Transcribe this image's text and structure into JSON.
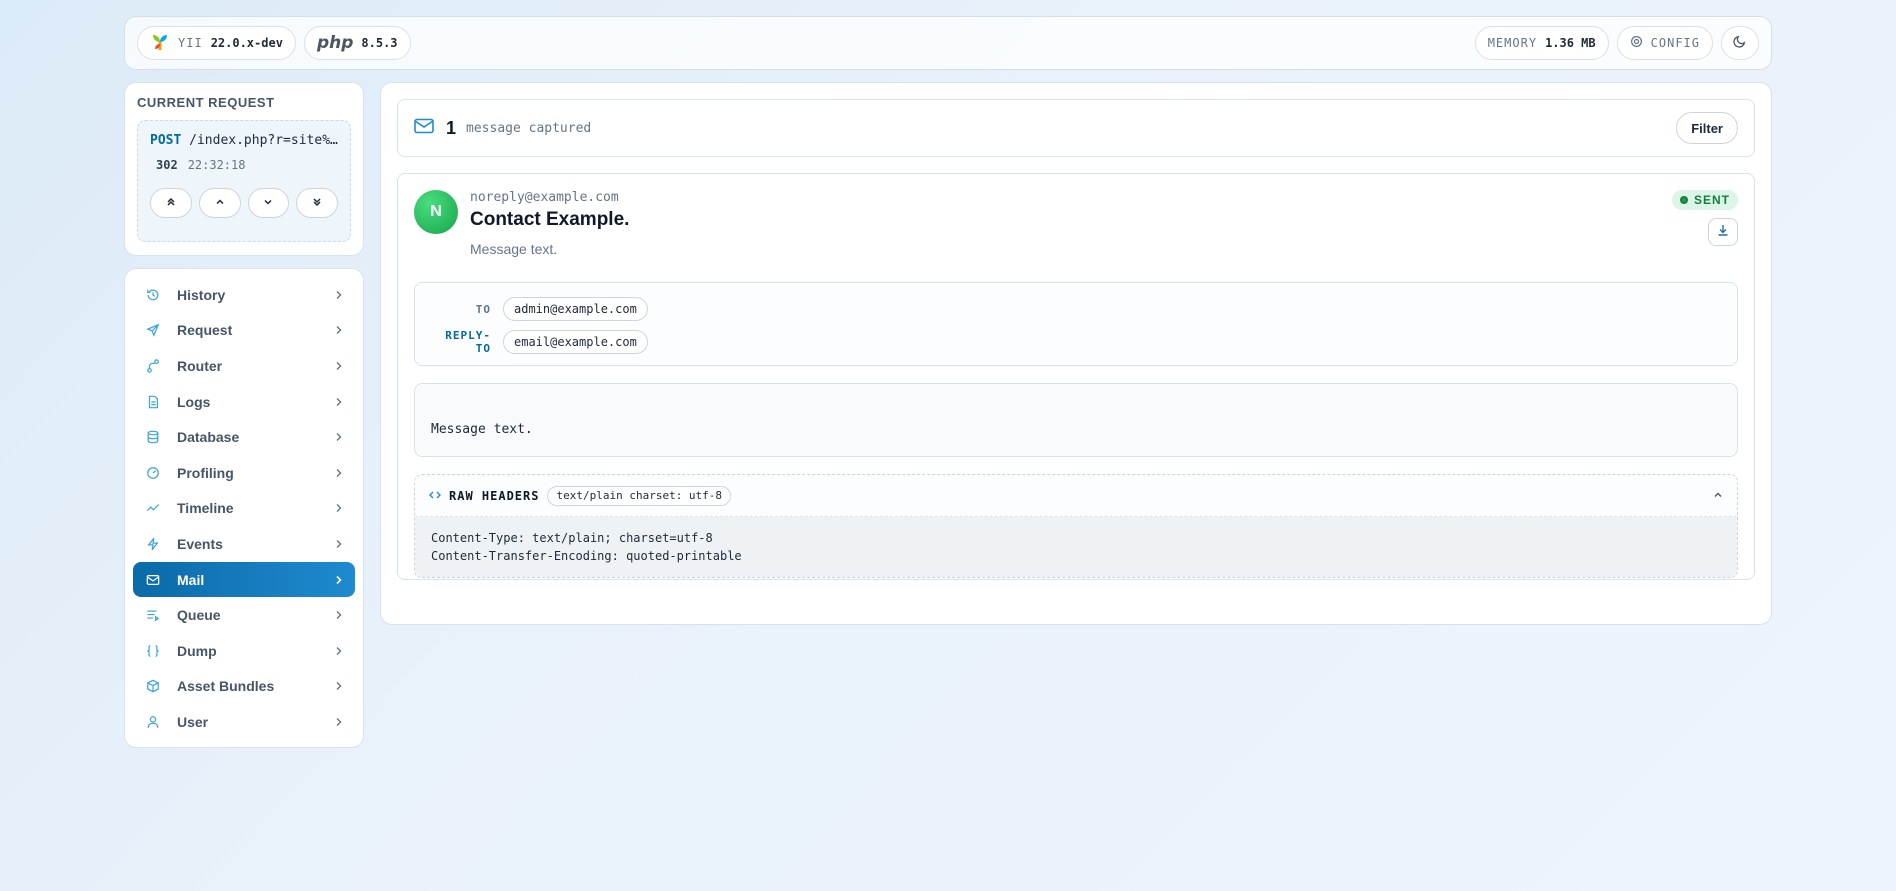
{
  "topbar": {
    "framework_label": "YII",
    "framework_version": "22.0.x-dev",
    "php_label": "php",
    "php_version": "8.5.3",
    "memory_label": "MEMORY",
    "memory_value": "1.36 MB",
    "config_label": "CONFIG",
    "theme_icon": "moon-icon"
  },
  "request": {
    "title": "CURRENT REQUEST",
    "method": "POST",
    "url": "/index.php?r=site%…",
    "status": "302",
    "time": "22:32:18",
    "nav_icons": [
      "chevrons-up-icon",
      "chevron-up-icon",
      "chevron-down-icon",
      "chevrons-down-icon"
    ]
  },
  "sidebar": {
    "items": [
      {
        "label": "History",
        "icon": "history-icon"
      },
      {
        "label": "Request",
        "icon": "send-icon"
      },
      {
        "label": "Router",
        "icon": "route-icon"
      },
      {
        "label": "Logs",
        "icon": "file-icon"
      },
      {
        "label": "Database",
        "icon": "database-icon"
      },
      {
        "label": "Profiling",
        "icon": "gauge-icon"
      },
      {
        "label": "Timeline",
        "icon": "trend-icon"
      },
      {
        "label": "Events",
        "icon": "bolt-icon"
      },
      {
        "label": "Mail",
        "icon": "mail-icon",
        "active": true
      },
      {
        "label": "Queue",
        "icon": "list-icon"
      },
      {
        "label": "Dump",
        "icon": "braces-icon"
      },
      {
        "label": "Asset Bundles",
        "icon": "box-icon"
      },
      {
        "label": "User",
        "icon": "user-icon"
      }
    ]
  },
  "main": {
    "count": "1",
    "captured_text": "message captured",
    "filter_label": "Filter",
    "mail": {
      "avatar_letter": "N",
      "from": "noreply@example.com",
      "subject": "Contact Example.",
      "preview": "Message text.",
      "status": "SENT",
      "to_label": "TO",
      "to_value": "admin@example.com",
      "reply_to_label": "REPLY-TO",
      "reply_to_value": "email@example.com",
      "body": "Message text.",
      "raw_headers_title": "RAW HEADERS",
      "content_type_tag": "text/plain charset: utf-8",
      "header_line_1": "Content-Type: text/plain; charset=utf-8",
      "header_line_2": "Content-Transfer-Encoding: quoted-printable"
    }
  },
  "colors": {
    "accent": "#0b6aa8",
    "success": "#16a34a"
  }
}
